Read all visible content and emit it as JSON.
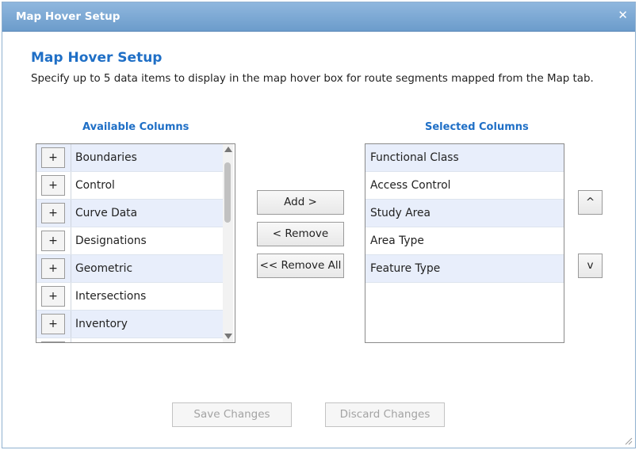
{
  "dialog": {
    "window_title": "Map Hover Setup",
    "heading": "Map Hover Setup",
    "description": "Specify up to 5 data items to display in the map hover box for route segments mapped from the Map tab."
  },
  "available": {
    "title": "Available Columns",
    "plus_label": "+",
    "items": [
      {
        "label": "Boundaries"
      },
      {
        "label": "Control"
      },
      {
        "label": "Curve Data"
      },
      {
        "label": "Designations"
      },
      {
        "label": "Geometric"
      },
      {
        "label": "Intersections"
      },
      {
        "label": "Inventory"
      }
    ]
  },
  "selected": {
    "title": "Selected Columns",
    "items": [
      {
        "label": "Functional Class"
      },
      {
        "label": "Access Control"
      },
      {
        "label": "Study Area"
      },
      {
        "label": "Area Type"
      },
      {
        "label": "Feature Type"
      }
    ]
  },
  "actions": {
    "add": "Add >",
    "remove": "< Remove",
    "remove_all": "<< Remove All",
    "move_up": "^",
    "move_down": "v"
  },
  "footer": {
    "save": "Save Changes",
    "discard": "Discard Changes"
  }
}
